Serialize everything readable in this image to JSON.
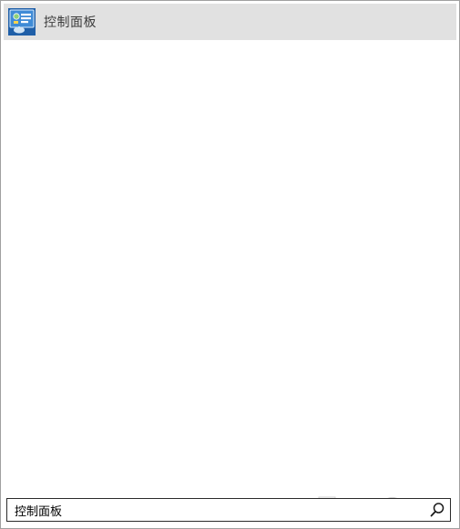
{
  "results": [
    {
      "label": "控制面板",
      "icon": "control-panel-icon"
    }
  ],
  "search": {
    "value": "控制面板",
    "icon": "search-icon"
  },
  "watermark": {
    "icon": "watermark-logo"
  },
  "colors": {
    "selected_background": "#e1e1e1",
    "border": "#a0a0a0",
    "search_border": "#2b2b2b",
    "icon_blue": "#1f5fa8"
  }
}
